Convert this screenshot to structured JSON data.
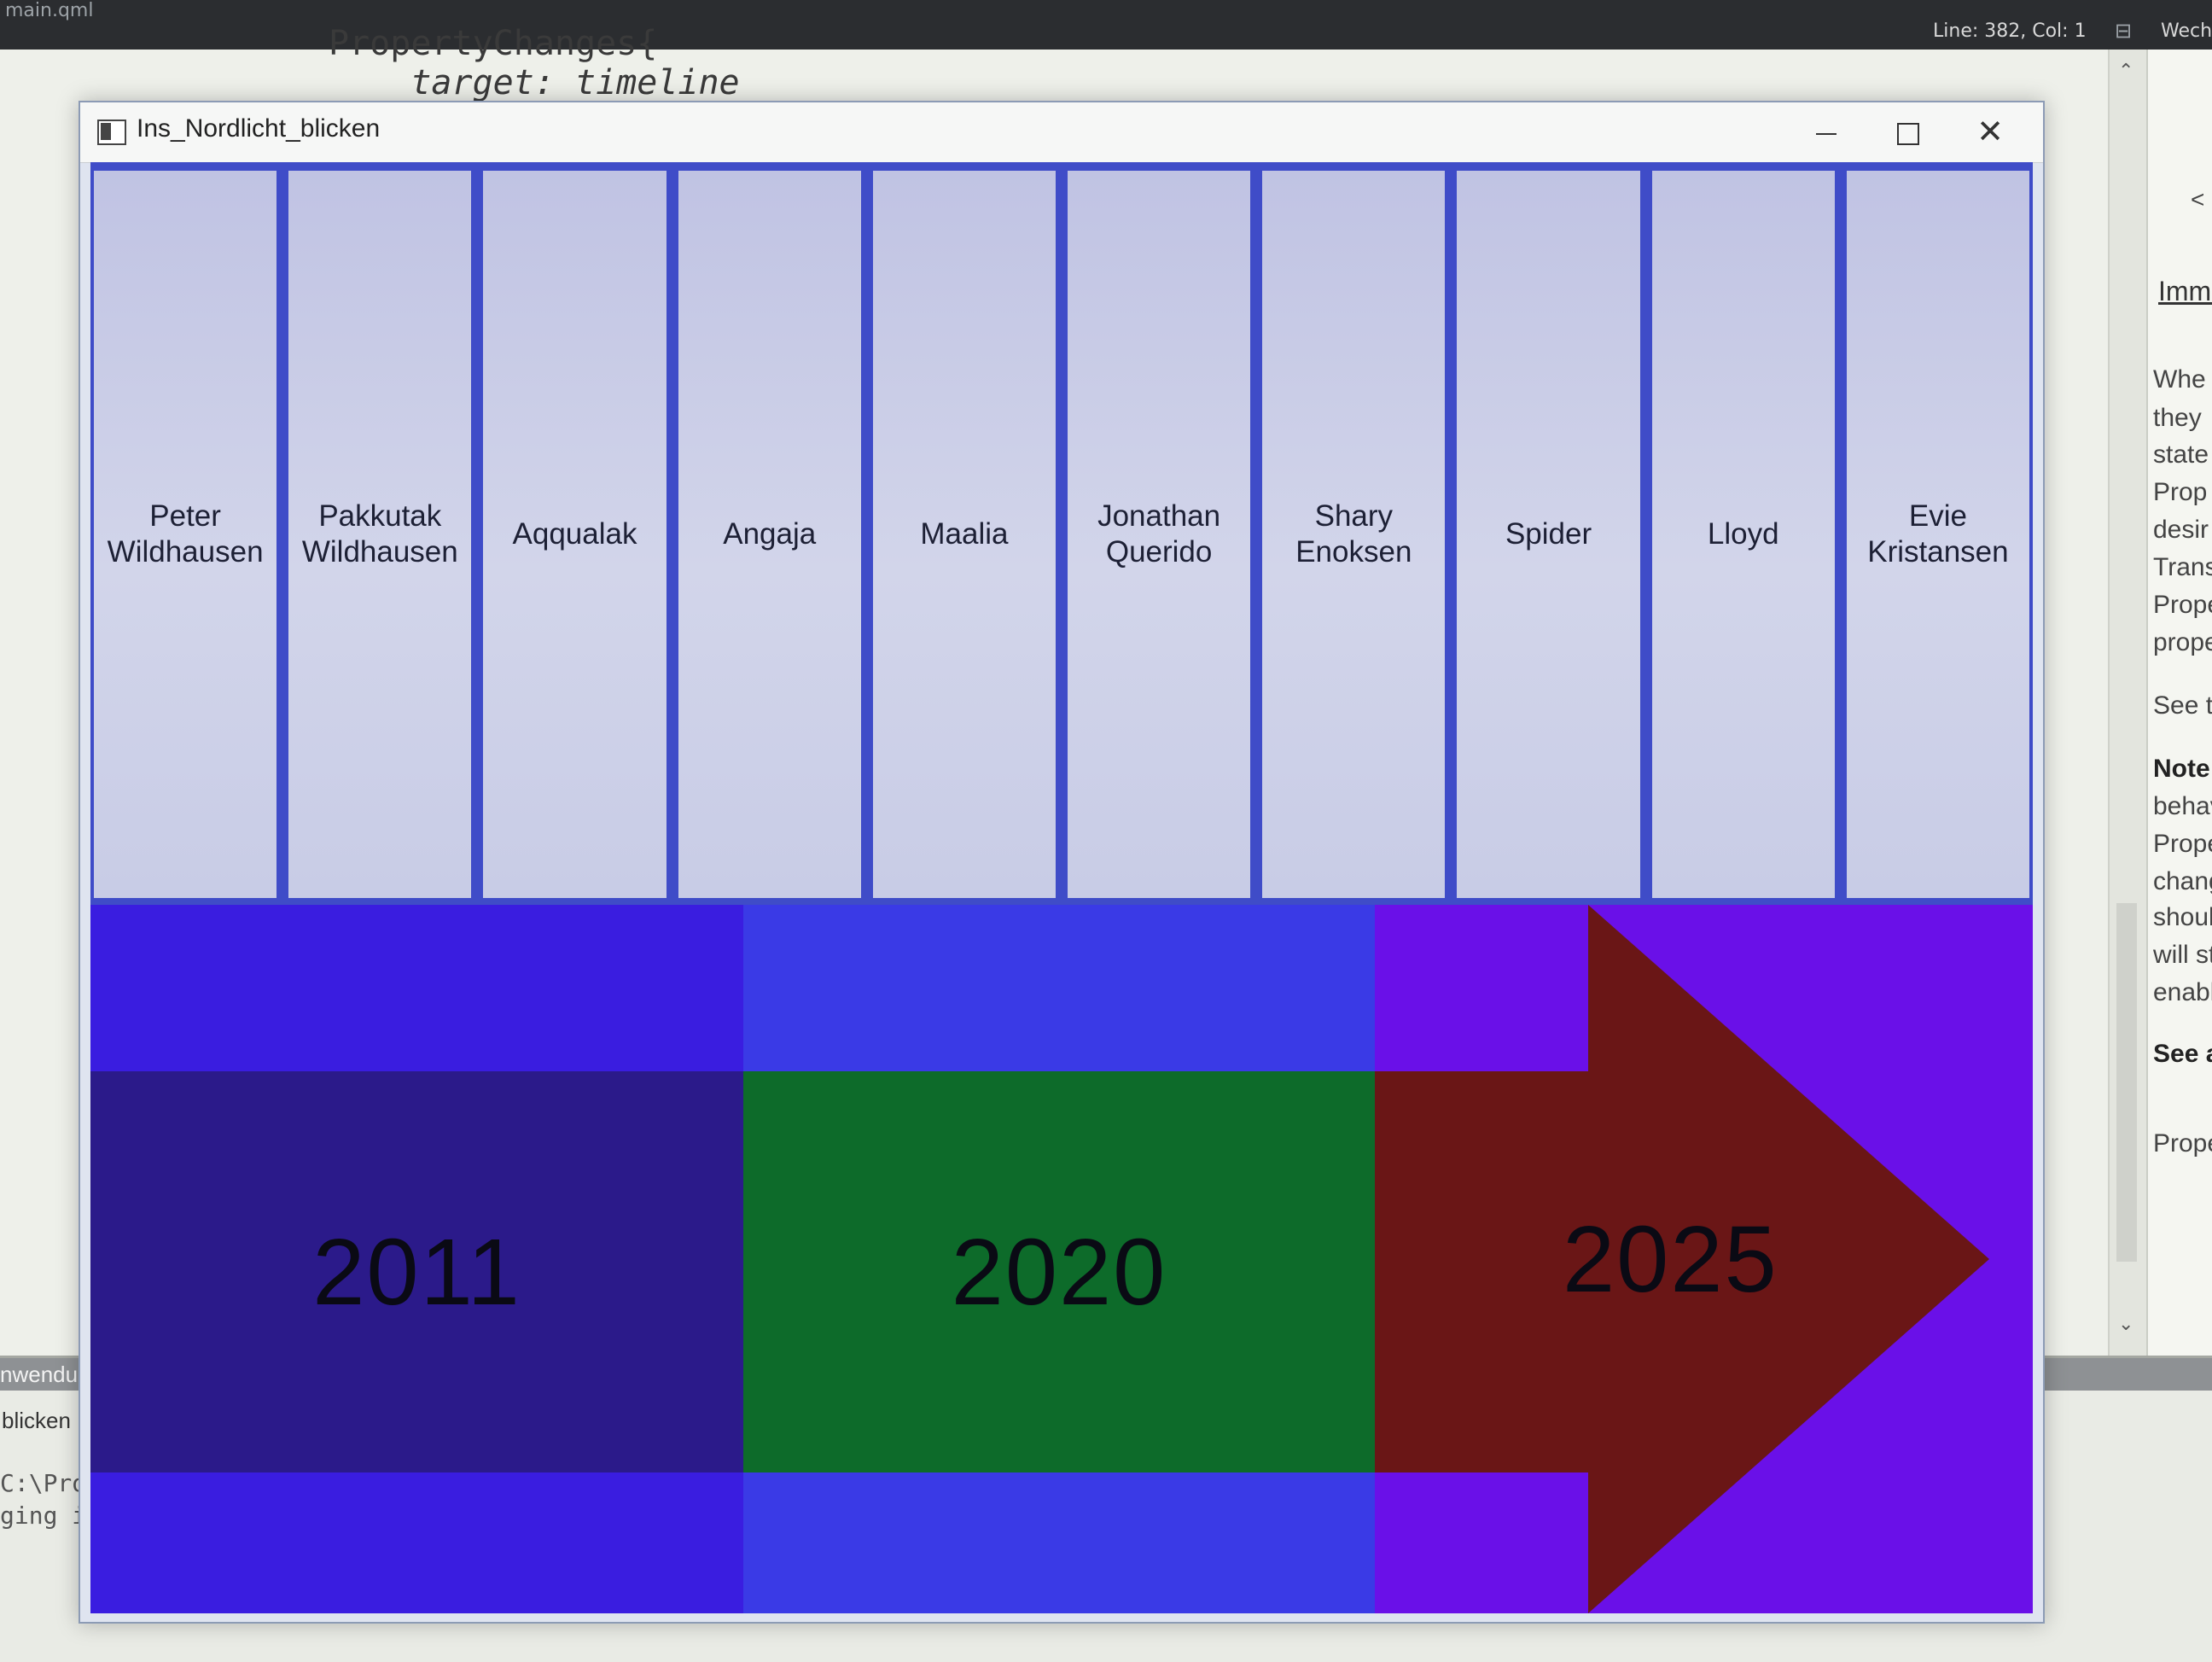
{
  "ide": {
    "file_name": "main.qml",
    "cursor_position": "Line: 382, Col: 1",
    "mode_label": "Wech",
    "code_lines": [
      "PropertyChanges{",
      "    target: timeline"
    ],
    "help_tab_arrow": "<",
    "help_link": "Imme",
    "help_lines": [
      "Whe",
      "they",
      "state",
      "Prop",
      "desir",
      "Trans",
      "Prope",
      "prope",
      "See t",
      "Note:",
      "behav",
      "Prope",
      "chang",
      "shoulc",
      "will stil",
      "enable",
      "See al",
      "Prope"
    ],
    "output_tab": "nwendung",
    "output_file": "blicken",
    "output_lines": [
      "C:\\Proj",
      "ging is"
    ]
  },
  "window": {
    "title": "Ins_Nordlicht_blicken",
    "minimize_symbol": "",
    "close_symbol": "✕"
  },
  "names": [
    "Peter Wildhausen",
    "Pakkutak Wildhausen",
    "Aqqualak",
    "Angaja",
    "Maalia",
    "Jonathan Querido",
    "Shary Enoksen",
    "Spider",
    "Lloyd",
    "Evie Kristansen"
  ],
  "timeline": [
    {
      "year": "2011",
      "color": "#2b1a8a",
      "band_color": "#3a1de0"
    },
    {
      "year": "2020",
      "color": "#0d6b2a",
      "band_color": "#3a3ae6"
    },
    {
      "year": "2025",
      "color": "#6a1616",
      "band_color": "#6a10e8"
    }
  ]
}
